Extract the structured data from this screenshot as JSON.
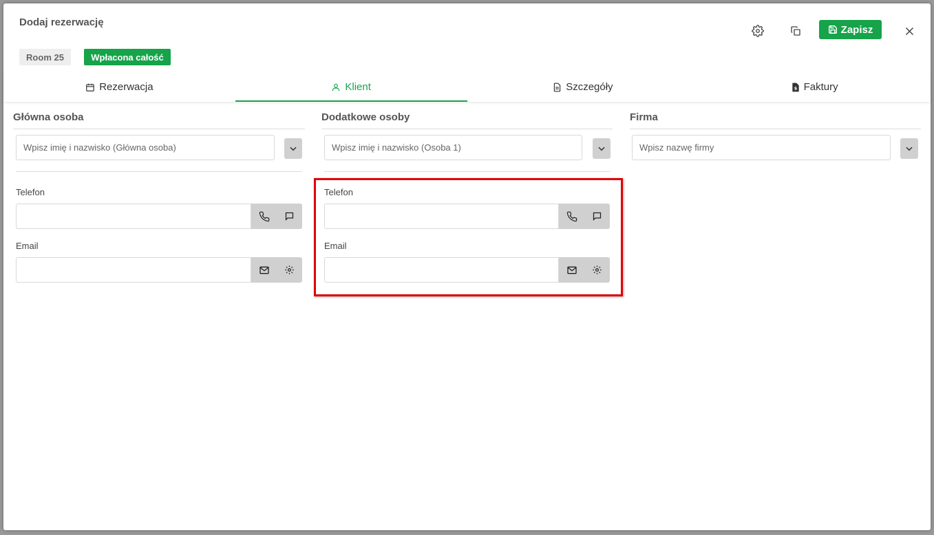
{
  "modal": {
    "title": "Dodaj rezerwację",
    "save_label": "Zapisz",
    "room_badge": "Room 25",
    "status_badge": "Wpłacona całość"
  },
  "colors": {
    "accent": "#16a34a",
    "highlight": "#e00000"
  },
  "tabs": [
    {
      "label": "Rezerwacja",
      "icon": "calendar-icon"
    },
    {
      "label": "Klient",
      "icon": "user-icon",
      "active": true
    },
    {
      "label": "Szczegóły",
      "icon": "document-icon"
    },
    {
      "label": "Faktury",
      "icon": "invoice-icon"
    }
  ],
  "main_person": {
    "title": "Główna osoba",
    "name_placeholder": "Wpisz imię i nazwisko (Główna osoba)",
    "phone_label": "Telefon",
    "phone_value": "",
    "email_label": "Email",
    "email_value": ""
  },
  "additional_persons": {
    "title": "Dodatkowe osoby",
    "name_placeholder": "Wpisz imię i nazwisko (Osoba 1)",
    "phone_label": "Telefon",
    "phone_value": "",
    "email_label": "Email",
    "email_value": ""
  },
  "company": {
    "title": "Firma",
    "name_placeholder": "Wpisz nazwę firmy"
  }
}
